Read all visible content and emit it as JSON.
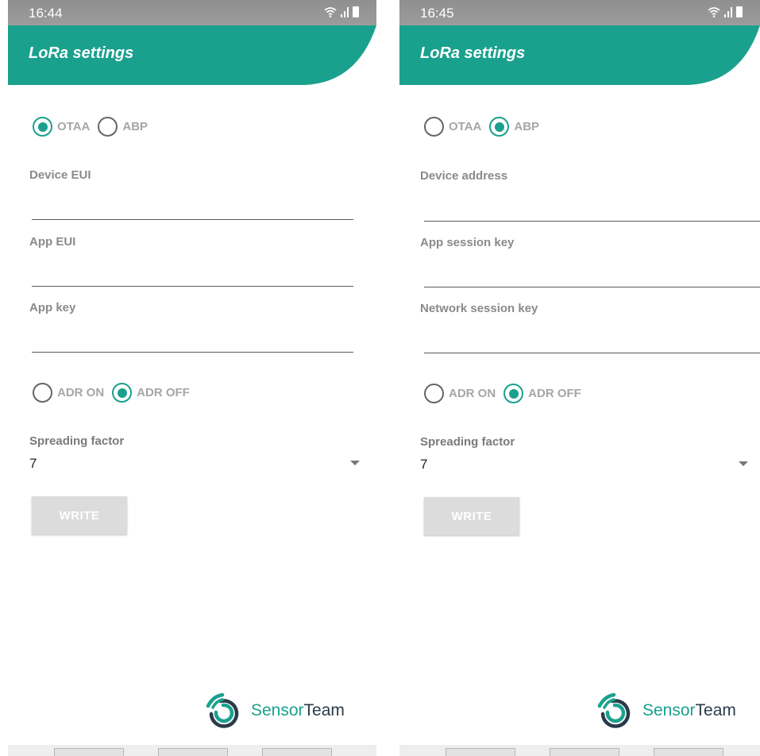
{
  "colors": {
    "accent": "#1aa18e",
    "status_bar": "#969696",
    "disabled_button": "#dcdcdc",
    "logo_dark": "#2b3a48"
  },
  "screens": [
    {
      "status": {
        "time": "16:44"
      },
      "title": "LoRa settings",
      "join_mode": {
        "options": [
          "OTAA",
          "ABP"
        ],
        "selected": "OTAA"
      },
      "fields": [
        {
          "label": "Device EUI",
          "value": ""
        },
        {
          "label": "App EUI",
          "value": ""
        },
        {
          "label": "App key",
          "value": ""
        }
      ],
      "adr": {
        "options": [
          "ADR ON",
          "ADR OFF"
        ],
        "selected": "ADR OFF"
      },
      "spreading_factor": {
        "label": "Spreading factor",
        "value": "7"
      },
      "write_label": "WRITE",
      "logo": {
        "part1": "Sensor",
        "part2": "Team"
      }
    },
    {
      "status": {
        "time": "16:45"
      },
      "title": "LoRa settings",
      "join_mode": {
        "options": [
          "OTAA",
          "ABP"
        ],
        "selected": "ABP"
      },
      "fields": [
        {
          "label": "Device address",
          "value": ""
        },
        {
          "label": "App session key",
          "value": ""
        },
        {
          "label": "Network session key",
          "value": ""
        }
      ],
      "adr": {
        "options": [
          "ADR ON",
          "ADR OFF"
        ],
        "selected": "ADR OFF"
      },
      "spreading_factor": {
        "label": "Spreading factor",
        "value": "7"
      },
      "write_label": "WRITE",
      "logo": {
        "part1": "Sensor",
        "part2": "Team"
      }
    }
  ]
}
